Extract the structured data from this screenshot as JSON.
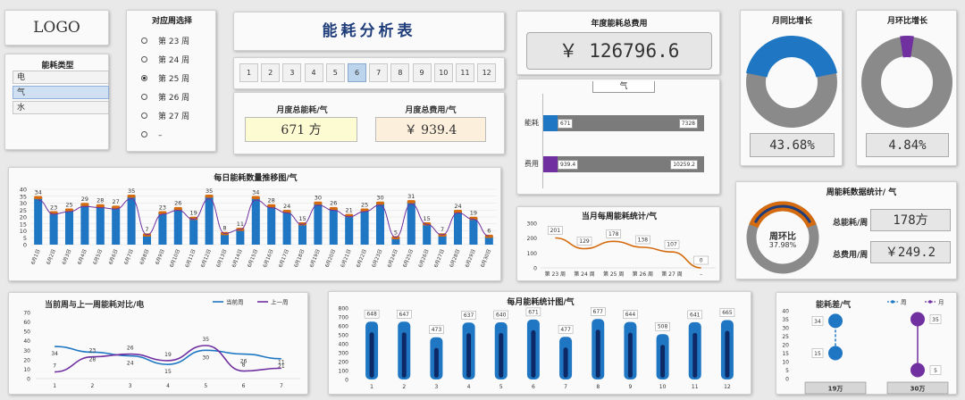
{
  "logo": {
    "text": "LOGO"
  },
  "energy_type": {
    "title": "能耗类型",
    "items": [
      "电",
      "气",
      "水"
    ],
    "selected": 1
  },
  "week_select": {
    "title": "对应周选择",
    "items": [
      "第 23 周",
      "第 24 周",
      "第 25 周",
      "第 26 周",
      "第 27 周",
      "–"
    ],
    "selected": 2
  },
  "dashboard_title": "能耗分析表",
  "months": {
    "items": [
      "1",
      "2",
      "3",
      "4",
      "5",
      "6",
      "7",
      "8",
      "9",
      "10",
      "11",
      "12"
    ],
    "selected": 5
  },
  "monthly_kpi": {
    "energy_label": "月度总能耗/气",
    "energy_value": "671 方",
    "cost_label": "月度总费用/气",
    "cost_value": "￥ 939.4"
  },
  "annual_cost": {
    "title": "年度能耗总费用",
    "value": "￥ 126796.6",
    "tab_label": "气"
  },
  "progress_bars": {
    "rows": [
      {
        "label": "能耗",
        "value": 671,
        "value_label": "671",
        "total": 7328,
        "total_label": "7328",
        "color": "#1f77c4"
      },
      {
        "label": "费用",
        "value": 939.4,
        "value_label": "939.4",
        "total": 10259.2,
        "total_label": "10259.2",
        "color": "#7030a0"
      }
    ]
  },
  "yoy": {
    "title": "月同比增长",
    "value_text": "43.68%",
    "value": 0.4368,
    "color": "#1f77c4",
    "track": "#8a8a8a"
  },
  "mom": {
    "title": "月环比增长",
    "value_text": "4.84%",
    "value": 0.0484,
    "color": "#7030a0",
    "track": "#8a8a8a"
  },
  "weekly_stats": {
    "title": "周能耗数据统计/ 气",
    "ring_label": "周环比",
    "ring_value": "37.98%",
    "ring_fraction": 0.3798,
    "energy_label": "总能耗/周",
    "energy_value": "178方",
    "cost_label": "总费用/周",
    "cost_value": "￥249.2",
    "colors": {
      "outer": "#d46b0f",
      "inner": "#1f3d7a",
      "track": "#8a8a8a"
    }
  },
  "daily_chart": {
    "title": "每日能耗数量推移图/气",
    "chart_data": {
      "type": "bar",
      "title": "每日能耗数量推移图/气",
      "categories": [
        "6月1日",
        "6月2日",
        "6月3日",
        "6月4日",
        "6月5日",
        "6月6日",
        "6月7日",
        "6月8日",
        "6月9日",
        "6月10日",
        "6月11日",
        "6月12日",
        "6月13日",
        "6月14日",
        "6月15日",
        "6月16日",
        "6月17日",
        "6月18日",
        "6月19日",
        "6月20日",
        "6月21日",
        "6月22日",
        "6月23日",
        "6月24日",
        "6月25日",
        "6月26日",
        "6月27日",
        "6月28日",
        "6月29日",
        "6月30日"
      ],
      "values": [
        34,
        23,
        25,
        29,
        28,
        27,
        35,
        7,
        23,
        26,
        19,
        35,
        8,
        11,
        34,
        28,
        24,
        15,
        30,
        26,
        21,
        25,
        30,
        5,
        31,
        15,
        7,
        24,
        19,
        6
      ],
      "ylim": [
        0,
        40
      ],
      "yticks": [
        0,
        5,
        10,
        15,
        20,
        25,
        30,
        35,
        40
      ],
      "colors": {
        "bar": "#1f77c4",
        "cap": "#d46b0f",
        "line": "#7030a0"
      },
      "grid": true
    }
  },
  "weekly_line": {
    "title": "当月每周能耗统计/气",
    "chart_data": {
      "type": "line",
      "title": "当月每周能耗统计/气",
      "categories": [
        "第 23 周",
        "第 24 周",
        "第 25 周",
        "第 26 周",
        "第 27 周",
        "–"
      ],
      "values": [
        201,
        129,
        178,
        138,
        107,
        0
      ],
      "ylim": [
        0,
        300
      ],
      "yticks": [
        0,
        100,
        200,
        300
      ],
      "colors": {
        "line": "#d46b0f"
      }
    }
  },
  "week_compare": {
    "title": "当前周与上一周能耗对比/电",
    "chart_data": {
      "type": "line",
      "title": "当前周与上一周能耗对比/电",
      "categories": [
        "1",
        "2",
        "3",
        "4",
        "5",
        "6",
        "7"
      ],
      "series": [
        {
          "name": "当前周",
          "values": [
            34,
            28,
            24,
            15,
            30,
            26,
            21
          ],
          "color": "#1f77c4"
        },
        {
          "name": "上一周",
          "values": [
            7,
            23,
            26,
            19,
            35,
            8,
            11
          ],
          "color": "#7030a0"
        }
      ],
      "ylim": [
        0,
        70
      ],
      "yticks": [
        0,
        10,
        20,
        30,
        40,
        50,
        60,
        70
      ],
      "legend": "top-right"
    }
  },
  "monthly_bars": {
    "title": "每月能耗统计图/气",
    "chart_data": {
      "type": "bar",
      "title": "每月能耗统计图/气",
      "categories": [
        "1",
        "2",
        "3",
        "4",
        "5",
        "6",
        "7",
        "8",
        "9",
        "10",
        "11",
        "12"
      ],
      "values": [
        648,
        647,
        473,
        637,
        640,
        671,
        477,
        677,
        644,
        508,
        641,
        665
      ],
      "ylim": [
        0,
        800
      ],
      "yticks": [
        0,
        100,
        200,
        300,
        400,
        500,
        600,
        700,
        800
      ],
      "colors": {
        "bar": "#1f77c4",
        "inner": "#0d2a66"
      }
    }
  },
  "diff_chart": {
    "title": "能耗差/气",
    "chart_data": {
      "type": "scatter",
      "title": "能耗差/气",
      "categories": [
        "19万",
        "30万"
      ],
      "series": [
        {
          "name": "周",
          "values": [
            34,
            15
          ],
          "color": "#1f77c4"
        },
        {
          "name": "月",
          "values": [
            35,
            5
          ],
          "color": "#7030a0"
        }
      ],
      "ylim": [
        0,
        40
      ],
      "yticks": [
        0,
        5,
        10,
        15,
        20,
        25,
        30,
        35,
        40
      ],
      "legend": "top-right"
    }
  }
}
